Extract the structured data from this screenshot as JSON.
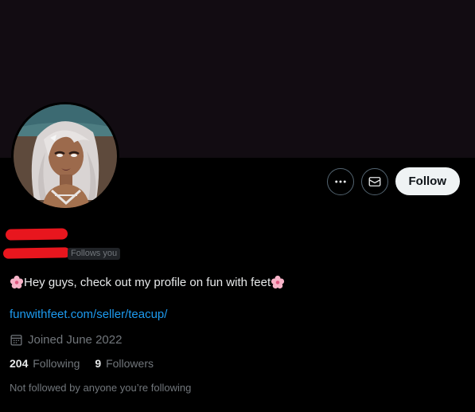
{
  "profile": {
    "follows_you": "Follows you",
    "bio": "Hey guys, check out my profile on fun with feet",
    "website": "funwithfeet.com/seller/teacup/",
    "joined": "Joined June 2022",
    "following_count": "204",
    "following_label": "Following",
    "followers_count": "9",
    "followers_label": "Followers",
    "mutuals_note": "Not followed by anyone you’re following"
  },
  "actions": {
    "more_icon": "more-horizontal-icon",
    "message_icon": "mail-icon",
    "follow_label": "Follow"
  },
  "icons": {
    "bio_emoji": "cherry-blossom-icon",
    "calendar": "calendar-icon"
  },
  "colors": {
    "background": "#000000",
    "banner": "#120c12",
    "link": "#1d9bf0",
    "muted_text": "#71767b",
    "primary_text": "#e7e9ea",
    "redaction": "#e8161e"
  }
}
